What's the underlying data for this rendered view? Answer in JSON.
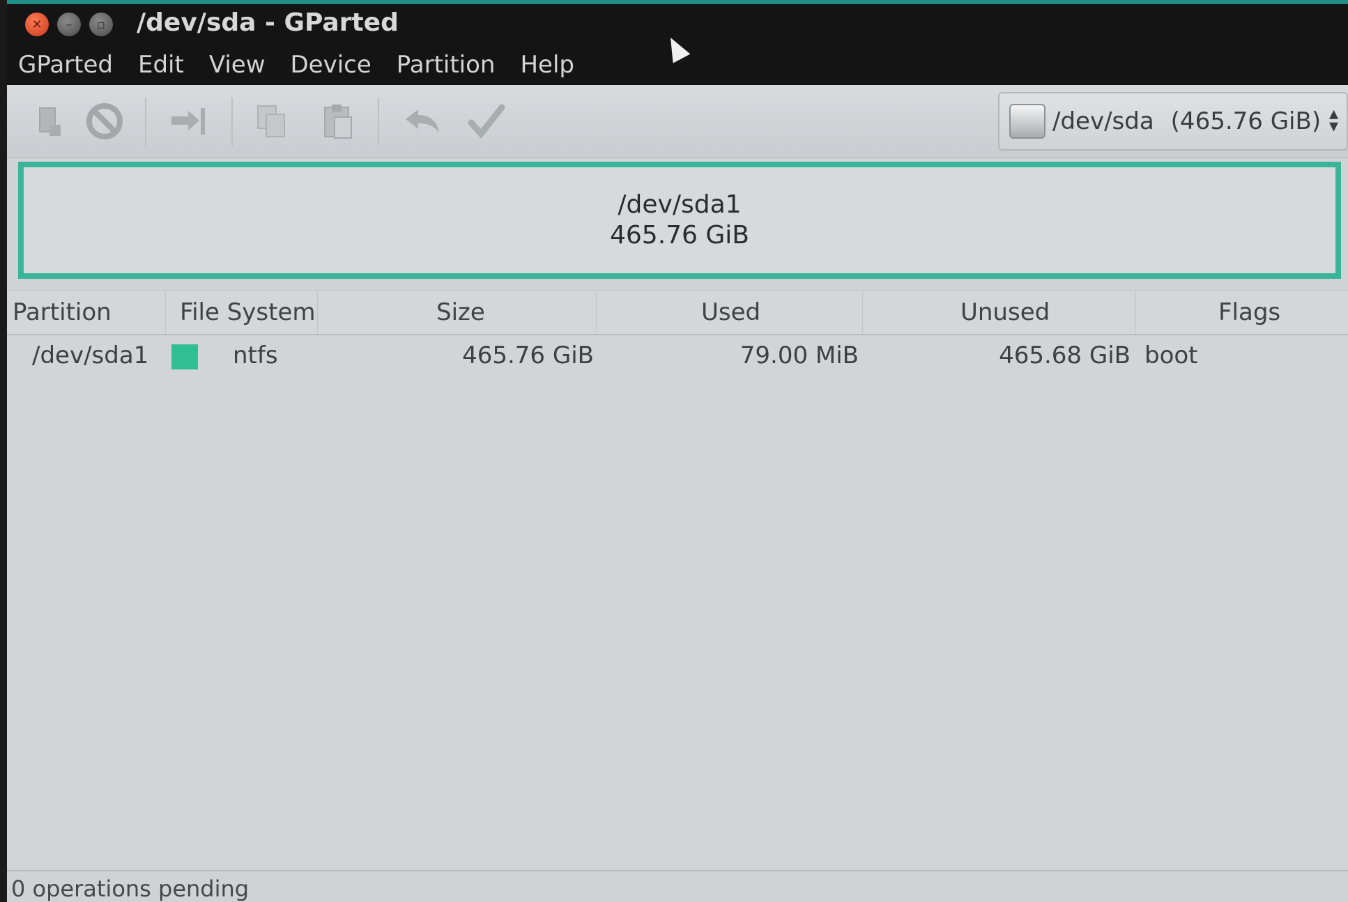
{
  "window": {
    "title": "/dev/sda - GParted"
  },
  "menu": [
    "GParted",
    "Edit",
    "View",
    "Device",
    "Partition",
    "Help"
  ],
  "device_selector": {
    "name": "/dev/sda",
    "size": "(465.76 GiB)"
  },
  "disk_map": {
    "partition": "/dev/sda1",
    "size": "465.76 GiB",
    "color": "#3bb59a"
  },
  "table": {
    "headers": [
      "Partition",
      "File System",
      "Size",
      "Used",
      "Unused",
      "Flags"
    ],
    "rows": [
      {
        "partition": "/dev/sda1",
        "fs_color": "#2fbf93",
        "filesystem": "ntfs",
        "size": "465.76 GiB",
        "used": "79.00 MiB",
        "unused": "465.68 GiB",
        "flags": "boot"
      }
    ]
  },
  "status": "0 operations pending"
}
